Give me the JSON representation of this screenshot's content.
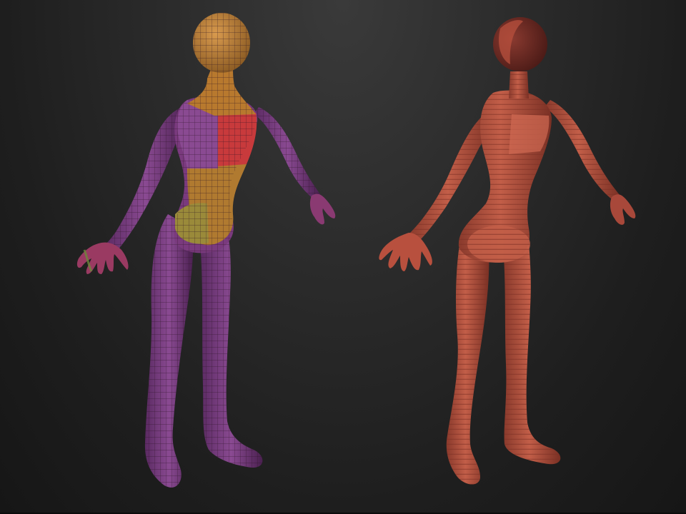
{
  "viewport": {
    "background_top": "#3a3a3a",
    "background_bottom": "#161616"
  },
  "models": [
    {
      "name": "polygroup-wireframe-figure",
      "shading": "polygroups-with-wireframe",
      "colors": {
        "head": "#b8792e",
        "chest": "#c83a3c",
        "torso": "#b07a30",
        "limbs": "#7a3a7e",
        "hips": "#9a8a3a",
        "wire": "#2a1222"
      }
    },
    {
      "name": "zsphere-skin-figure",
      "shading": "clay-red-bands",
      "colors": {
        "skin": "#b8503e",
        "skin_dark": "#7a2e24",
        "skin_light": "#d06a52",
        "band": "#8a3a2e"
      }
    }
  ]
}
